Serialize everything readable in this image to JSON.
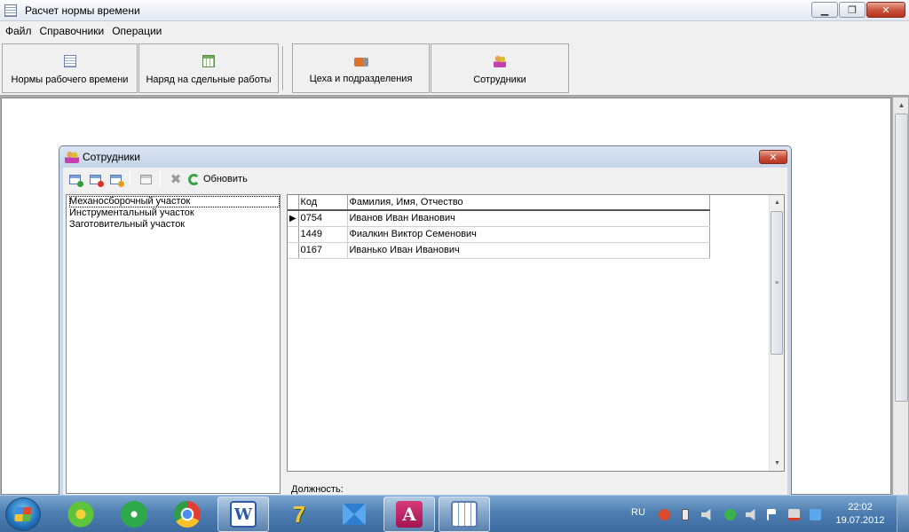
{
  "window": {
    "title": "Расчет нормы времени",
    "controls": {
      "minimize": "▁",
      "maximize": "❐",
      "close": "✕"
    }
  },
  "menu": {
    "items": [
      "Файл",
      "Справочники",
      "Операции"
    ]
  },
  "toolbar": {
    "buttons": [
      {
        "label": "Нормы рабочего времени",
        "icon": "document-list-icon"
      },
      {
        "label": "Наряд на сдельные работы",
        "icon": "table-icon"
      },
      {
        "label": "Цеха и подразделения",
        "icon": "truck-icon"
      },
      {
        "label": "Сотрудники",
        "icon": "people-icon"
      }
    ]
  },
  "child_window": {
    "title": "Сотрудники",
    "close": "✕",
    "toolbar": {
      "refresh_label": "Обновить",
      "icons": [
        "add-record-icon",
        "delete-record-icon",
        "edit-record-icon",
        "export-icon",
        "cancel-icon",
        "refresh-icon"
      ]
    },
    "departments": [
      "Механосборочный участок",
      "Инструментальный участок",
      "Заготовительный участок"
    ],
    "selected_department_index": 0,
    "grid": {
      "columns": [
        "Код",
        "Фамилия, Имя, Отчество"
      ],
      "rows": [
        [
          "0754",
          "Иванов Иван Иванович"
        ],
        [
          "1449",
          "Фиалкин Виктор Семенович"
        ],
        [
          "0167",
          "Иванько Иван Иванович"
        ]
      ],
      "current_row_index": 0,
      "row_pointer": "▶",
      "scroll_up": "▲",
      "scroll_down": "▼",
      "scroll_grip": "≡"
    },
    "position_label": "Должность:"
  },
  "taskbar": {
    "apps": [
      "icq-icon",
      "radio-icon",
      "chrome-icon",
      "word-icon",
      "seven-zip-icon",
      "dropbox-icon",
      "access-icon",
      "table-app-icon"
    ],
    "language": "RU",
    "time": "22:02",
    "date": "19.07.2012"
  },
  "colors": {
    "title_gradient_top": "#fdfdfe",
    "client_bg": "#ababab",
    "child_frame": "#cad6e6",
    "close_red": "#c7503b",
    "taskbar": "#4f7fb2"
  }
}
